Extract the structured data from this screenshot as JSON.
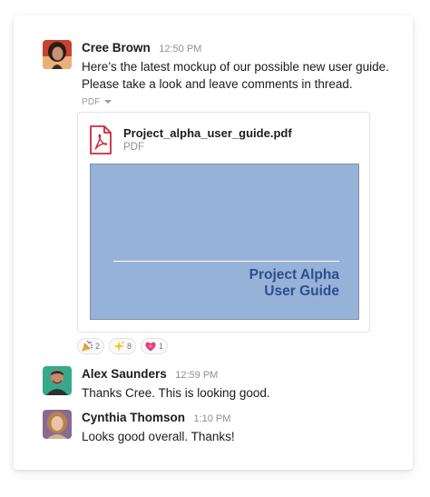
{
  "messages": [
    {
      "author": "Cree Brown",
      "time": "12:50 PM",
      "lines": [
        "Here’s the latest mockup of our possible new user guide.",
        "Please take a look and leave comments in thread."
      ],
      "pdf_toggle": "PDF",
      "attachment": {
        "file_name": "Project_alpha_user_guide.pdf",
        "file_type": "PDF",
        "preview_title_line1": "Project Alpha",
        "preview_title_line2": "User Guide"
      },
      "reactions": [
        {
          "icon": "party-popper-icon",
          "count": "2"
        },
        {
          "icon": "sparkles-icon",
          "count": "8"
        },
        {
          "icon": "sparkling-heart-icon",
          "count": "1"
        }
      ]
    },
    {
      "author": "Alex Saunders",
      "time": "12:59 PM",
      "text": "Thanks Cree. This is looking good."
    },
    {
      "author": "Cynthia Thomson",
      "time": "1:10 PM",
      "text": "Looks good overall. Thanks!"
    }
  ],
  "colors": {
    "preview_bg": "#97b2d8",
    "preview_title": "#2c4f8c",
    "pdf_red": "#d0283a"
  }
}
